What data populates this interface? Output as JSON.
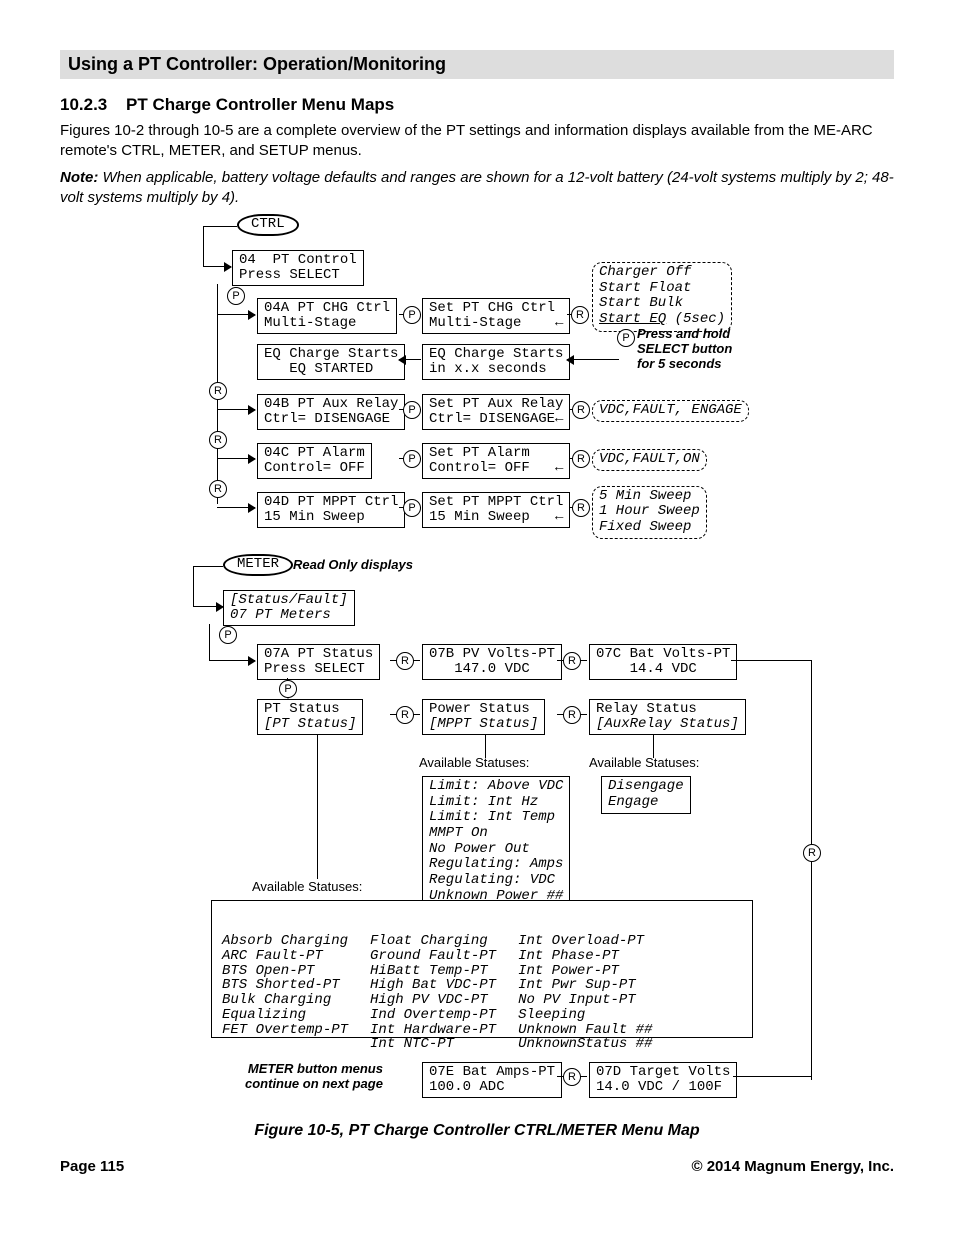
{
  "header": {
    "title": "Using a PT Controller: Operation/Monitoring"
  },
  "section": {
    "number": "10.2.3",
    "title": "PT Charge Controller Menu Maps"
  },
  "intro": "Figures 10-2 through 10-5 are a complete overview of the PT settings and information displays available from the ME-ARC remote's CTRL, METER, and SETUP menus.",
  "note_label": "Note:",
  "note_body": " When applicable, battery voltage defaults and ranges are shown for a 12-volt battery (24-volt systems multiply by 2; 48-volt systems multiply by 4).",
  "caption": "Figure 10-5, PT Charge Controller CTRL/METER Menu Map",
  "footer": {
    "page": "Page 115",
    "copyright": "© 2014 Magnum Energy, Inc."
  },
  "ovals": {
    "ctrl": "CTRL",
    "meter": "METER"
  },
  "meter_note": "Read Only displays",
  "ctrl_root": "04  PT Control\nPress SELECT",
  "ctrl_rows": {
    "r1": {
      "a": "04A PT CHG Ctrl\nMulti-Stage",
      "b": "Set PT CHG Ctrl\nMulti-Stage    ←",
      "opts": "Charger Off\nStart Float\nStart Bulk",
      "opts_eq": "Start EQ",
      "opts_eq_tail": " (5sec)",
      "hold": "Press and hold\nSELECT button\nfor 5 seconds"
    },
    "eq": {
      "a": "EQ Charge Starts\n   EQ STARTED",
      "b": "EQ Charge Starts\nin x.x seconds"
    },
    "r2": {
      "a": "04B PT Aux Relay\nCtrl= DISENGAGE",
      "b": "Set PT Aux Relay\nCtrl= DISENGAGE←",
      "opts": "VDC,FAULT, ENGAGE"
    },
    "r3": {
      "a": "04C PT Alarm\nControl= OFF",
      "b": "Set PT Alarm\nControl= OFF   ←",
      "opts": "VDC,FAULT,ON"
    },
    "r4": {
      "a": "04D PT MPPT Ctrl\n15 Min Sweep",
      "b": "Set PT MPPT Ctrl\n15 Min Sweep   ←",
      "opts": "5 Min Sweep\n1 Hour Sweep\nFixed Sweep"
    }
  },
  "meter_root": "[Status/Fault]\n07 PT Meters",
  "meter_row1": {
    "a": "07A PT Status\nPress SELECT",
    "b": "07B PV Volts-PT\n   147.0 VDC",
    "c": "07C Bat Volts-PT\n    14.4 VDC"
  },
  "meter_row2": {
    "a": "PT Status\n[PT Status]",
    "b": "Power Status\n[MPPT Status]",
    "c": "Relay Status\n[AuxRelay Status]"
  },
  "avail_hdr_pt": "Available Statuses:",
  "avail_hdr_pw": "Available Statuses:",
  "avail_hdr_rl": "Available Statuses:",
  "power_statuses": "Limit: Above VDC\nLimit: Int Hz\nLimit: Int Temp\nMMPT On\nNo Power Out\nRegulating: Amps\nRegulating: VDC\nUnknown Power ##",
  "relay_statuses": "Disengage\nEngage",
  "pt_statuses_col1": "Absorb Charging\nARC Fault-PT\nBTS Open-PT\nBTS Shorted-PT\nBulk Charging\nEqualizing\nFET Overtemp-PT",
  "pt_statuses_col2": "Float Charging\nGround Fault-PT\nHiBatt Temp-PT\nHigh Bat VDC-PT\nHigh PV VDC-PT\nInd Overtemp-PT\nInt Hardware-PT\nInt NTC-PT",
  "pt_statuses_col3": "Int Overload-PT\nInt Phase-PT\nInt Power-PT\nInt Pwr Sup-PT\nNo PV Input-PT\nSleeping\nUnknown Fault ##\nUnknownStatus ##",
  "meter_cont": "METER button menus\ncontinue on next page",
  "meter_row3": {
    "e": "07E Bat Amps-PT\n100.0 ADC",
    "d": "07D Target Volts\n14.0 VDC / 100F"
  },
  "badges": {
    "P": "P",
    "R": "R"
  }
}
